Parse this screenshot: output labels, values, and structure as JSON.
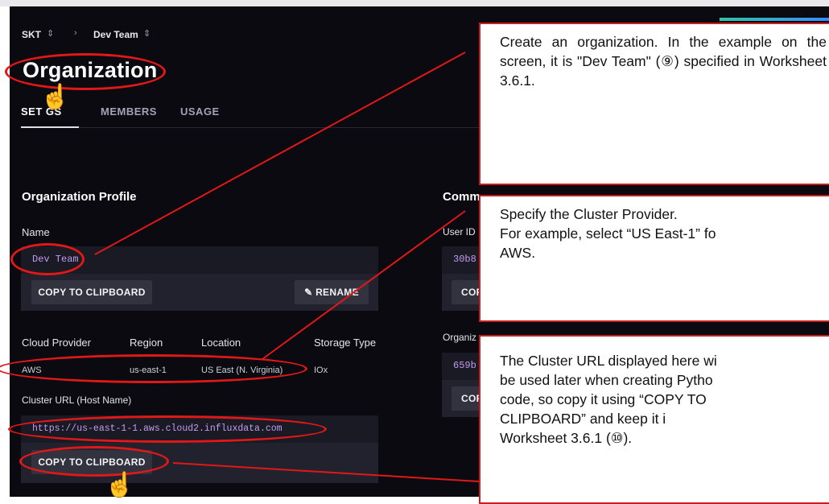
{
  "breadcrumb": {
    "org": "SKT",
    "team": "Dev Team",
    "separator": "›"
  },
  "page_title": "Organization",
  "tabs": [
    {
      "label": "SETTINGS",
      "display": "SET    GS",
      "active": true
    },
    {
      "label": "MEMBERS",
      "active": false
    },
    {
      "label": "USAGE",
      "active": false
    }
  ],
  "profile": {
    "heading": "Organization Profile",
    "name_label": "Name",
    "name_value": "Dev Team",
    "copy_button": "COPY TO CLIPBOARD",
    "rename_button": "RENAME",
    "columns": [
      "Cloud Provider",
      "Region",
      "Location",
      "Storage Type"
    ],
    "row": [
      "AWS",
      "us-east-1",
      "US East (N. Virginia)",
      "IOx"
    ],
    "cluster_label": "Cluster URL (Host Name)",
    "cluster_value": "https://us-east-1-1.aws.cloud2.influxdata.com",
    "cluster_copy_button": "COPY TO CLIPBOARD"
  },
  "common_ids": {
    "heading": "Comm",
    "user_id_label": "User ID",
    "user_id_value": "30b8",
    "user_copy": "COP",
    "org_id_label": "Organiz",
    "org_id_value": "659b",
    "org_copy": "COP"
  },
  "callouts": [
    "Create an organization. In the example on the screen, it is \"Dev Team\" (⑨) specified in Worksheet 3.6.1.",
    "Specify the Cluster Provider.\nFor example, select “US East-1” fo\nAWS.",
    "The Cluster URL displayed here wi\nbe used later when creating Pytho\ncode, so copy it using “COPY TO\nCLIPBOARD” and keep it i\nWorksheet 3.6.1 (⑩)."
  ],
  "colors": {
    "annotation_red": "#e01818",
    "ui_background": "#0a0a10",
    "mono_text": "#c39bf0"
  }
}
